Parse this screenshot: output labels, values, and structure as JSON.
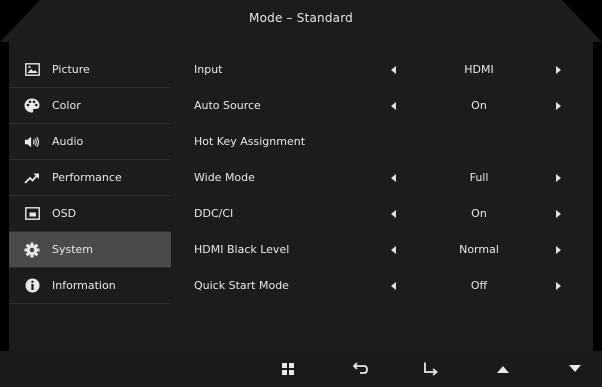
{
  "header": {
    "title": "Mode – Standard"
  },
  "sidebar": {
    "items": [
      {
        "label": "Picture",
        "icon": "picture-icon"
      },
      {
        "label": "Color",
        "icon": "palette-icon"
      },
      {
        "label": "Audio",
        "icon": "speaker-icon"
      },
      {
        "label": "Performance",
        "icon": "trend-arrow-icon"
      },
      {
        "label": "OSD",
        "icon": "osd-window-icon"
      },
      {
        "label": "System",
        "icon": "gear-icon",
        "selected": true
      },
      {
        "label": "Information",
        "icon": "info-icon"
      }
    ]
  },
  "settings": {
    "rows": [
      {
        "label": "Input",
        "value": "HDMI"
      },
      {
        "label": "Auto Source",
        "value": "On"
      },
      {
        "label": "Hot Key Assignment",
        "value": ""
      },
      {
        "label": "Wide Mode",
        "value": "Full"
      },
      {
        "label": "DDC/CI",
        "value": "On"
      },
      {
        "label": "HDMI Black Level",
        "value": "Normal"
      },
      {
        "label": "Quick Start Mode",
        "value": "Off"
      }
    ]
  },
  "footer": {
    "buttons": [
      "menu-grid-icon",
      "back-icon",
      "enter-icon",
      "up-icon",
      "down-icon"
    ]
  },
  "colors": {
    "background": "#000000",
    "panel": "#1c1c1c",
    "selected": "#4a4a4a",
    "text": "#e8e8e8"
  }
}
